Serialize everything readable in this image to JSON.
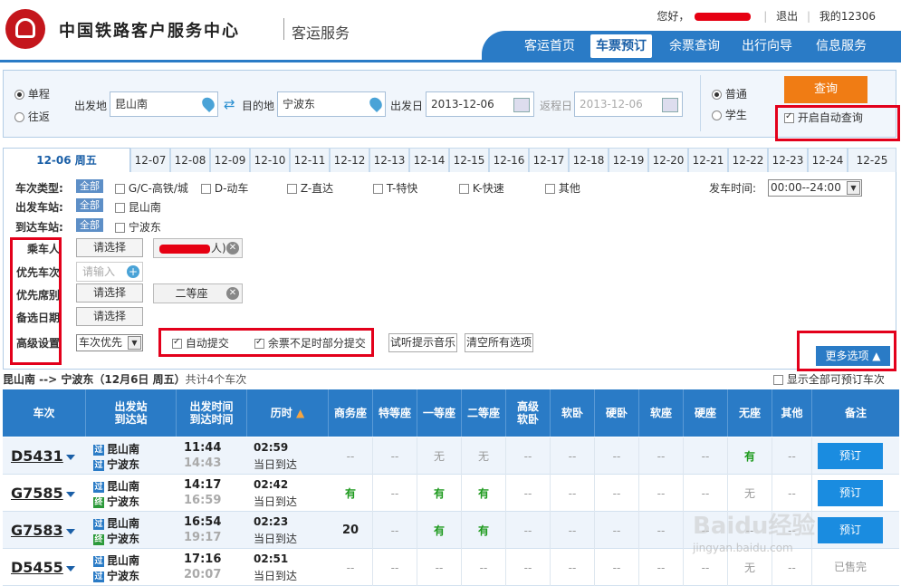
{
  "header": {
    "title": "中国铁路客户服务中心",
    "subtitle": "客运服务",
    "greeting": "您好，",
    "logout": "退出",
    "my12306": "我的12306"
  },
  "nav": {
    "items": [
      {
        "label": "客运首页",
        "active": false
      },
      {
        "label": "车票预订",
        "active": true
      },
      {
        "label": "余票查询",
        "active": false
      },
      {
        "label": "出行向导",
        "active": false
      },
      {
        "label": "信息服务",
        "active": false
      }
    ]
  },
  "query": {
    "oneway": "单程",
    "roundtrip": "往返",
    "from_label": "出发地",
    "from_value": "昆山南",
    "to_label": "目的地",
    "to_value": "宁波东",
    "date_label": "出发日",
    "date_value": "2013-12-06",
    "return_label": "返程日",
    "return_value": "2013-12-06",
    "normal": "普通",
    "student": "学生",
    "search_button": "查询",
    "auto_query": "开启自动查询"
  },
  "dates": [
    "12-06 周五",
    "12-07",
    "12-08",
    "12-09",
    "12-10",
    "12-11",
    "12-12",
    "12-13",
    "12-14",
    "12-15",
    "12-16",
    "12-17",
    "12-18",
    "12-19",
    "12-20",
    "12-21",
    "12-22",
    "12-23",
    "12-24",
    "12-25"
  ],
  "filters": {
    "train_type_label": "车次类型:",
    "all": "全部",
    "types": [
      "G/C-高铁/城",
      "D-动车",
      "Z-直达",
      "T-特快",
      "K-快速",
      "其他"
    ],
    "dep_time_label": "发车时间:",
    "dep_time_value": "00:00--24:00",
    "from_station_label": "出发车站:",
    "from_station": "昆山南",
    "to_station_label": "到达车站:",
    "to_station": "宁波东",
    "passenger_label": "乘车人",
    "choose": "请选择",
    "passenger_value": "人)",
    "priority_train_label": "优先车次",
    "input_placeholder": "请输入",
    "priority_seat_label": "优先席别",
    "seat_value": "二等座",
    "backup_date_label": "备选日期",
    "advanced_label": "高级设置",
    "advanced_select": "车次优先",
    "auto_submit": "自动提交",
    "partial_submit": "余票不足时部分提交",
    "test_music": "试听提示音乐",
    "clear_all": "清空所有选项",
    "more_options": "更多选项"
  },
  "route": {
    "text": "昆山南 --> 宁波东（12月6日  周五）",
    "count": "共计4个车次",
    "show_all": "显示全部可预订车次"
  },
  "table": {
    "headers": [
      "车次",
      "出发站\n到达站",
      "出发时间\n到达时间",
      "历时",
      "商务座",
      "特等座",
      "一等座",
      "二等座",
      "高级\n软卧",
      "软卧",
      "硬卧",
      "软座",
      "硬座",
      "无座",
      "其他",
      "备注"
    ],
    "rows": [
      {
        "no": "D5431",
        "from": "昆山南",
        "to": "宁波东",
        "from_tag": "过",
        "to_tag": "过",
        "dep": "11:44",
        "arr": "14:43",
        "dur": "02:59",
        "day": "当日到达",
        "seats": [
          "--",
          "--",
          "无",
          "无",
          "--",
          "--",
          "--",
          "--",
          "--",
          "有",
          "--"
        ],
        "action": "预订"
      },
      {
        "no": "G7585",
        "from": "昆山南",
        "to": "宁波东",
        "from_tag": "过",
        "to_tag": "终",
        "dep": "14:17",
        "arr": "16:59",
        "dur": "02:42",
        "day": "当日到达",
        "seats": [
          "有",
          "--",
          "有",
          "有",
          "--",
          "--",
          "--",
          "--",
          "--",
          "无",
          "--"
        ],
        "action": "预订"
      },
      {
        "no": "G7583",
        "from": "昆山南",
        "to": "宁波东",
        "from_tag": "过",
        "to_tag": "终",
        "dep": "16:54",
        "arr": "19:17",
        "dur": "02:23",
        "day": "当日到达",
        "seats": [
          "20",
          "--",
          "有",
          "有",
          "--",
          "--",
          "--",
          "--",
          "--",
          "--",
          "--"
        ],
        "action": "预订"
      },
      {
        "no": "D5455",
        "from": "昆山南",
        "to": "宁波东",
        "from_tag": "过",
        "to_tag": "过",
        "dep": "17:16",
        "arr": "20:07",
        "dur": "02:51",
        "day": "当日到达",
        "seats": [
          "--",
          "--",
          "--",
          "--",
          "--",
          "--",
          "--",
          "--",
          "--",
          "无",
          "--"
        ],
        "action": "已售完"
      }
    ]
  },
  "watermark": {
    "brand": "Baidu经验",
    "url": "jingyan.baidu.com"
  }
}
